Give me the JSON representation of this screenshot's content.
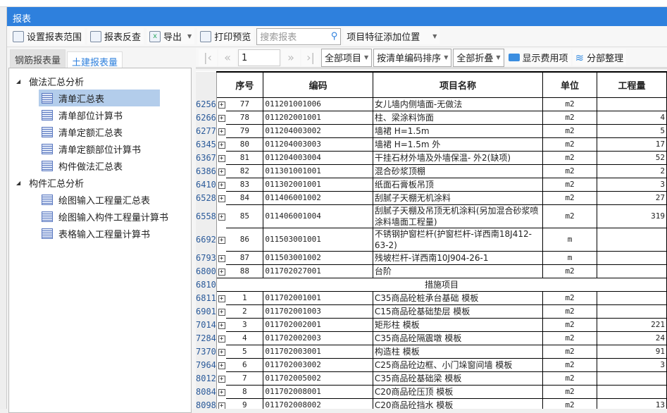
{
  "window": {
    "title": "报表"
  },
  "toolbar": {
    "set_range": "设置报表范围",
    "reverse_check": "报表反查",
    "export": "导出",
    "print_preview": "打印预览",
    "search_placeholder": "搜索报表",
    "feature_position": "项目特征添加位置"
  },
  "left": {
    "tabs": [
      {
        "label": "钢筋报表量",
        "active": false
      },
      {
        "label": "土建报表量",
        "active": true
      }
    ],
    "groups": [
      {
        "label": "做法汇总分析",
        "items": [
          "清单汇总表",
          "清单部位计算书",
          "清单定额汇总表",
          "清单定额部位计算书",
          "构件做法汇总表"
        ]
      },
      {
        "label": "构件汇总分析",
        "items": [
          "绘图输入工程量汇总表",
          "绘图输入构件工程量计算书",
          "表格输入工程量计算书"
        ]
      }
    ],
    "selected": "清单汇总表"
  },
  "pager": {
    "page": "1",
    "filter": "全部项目",
    "sort": "按清单编码排序",
    "fold": "全部折叠",
    "show_fee": "显示费用项",
    "section_arrange": "分部整理"
  },
  "table": {
    "headers": [
      "序号",
      "编码",
      "项目名称",
      "单位",
      "工程量"
    ],
    "rows": [
      {
        "line": "6256",
        "no": "77",
        "code": "011201001006",
        "name": "女儿墙内侧墙面-无做法",
        "unit": "m2",
        "qty": ""
      },
      {
        "line": "6266",
        "no": "78",
        "code": "011202001001",
        "name": "柱、梁涂料饰面",
        "unit": "m2",
        "qty": "4"
      },
      {
        "line": "6277",
        "no": "79",
        "code": "011204003002",
        "name": "墙裙 H=1.5m",
        "unit": "m2",
        "qty": "5"
      },
      {
        "line": "6345",
        "no": "80",
        "code": "011204003003",
        "name": "墙裙 H=1.5m 外",
        "unit": "m2",
        "qty": "17"
      },
      {
        "line": "6367",
        "no": "81",
        "code": "011204003004",
        "name": "干挂石材外墙及外墙保温- 外2(缺项)",
        "unit": "m2",
        "qty": "52"
      },
      {
        "line": "6386",
        "no": "82",
        "code": "011301001001",
        "name": "混合砂浆顶棚",
        "unit": "m2",
        "qty": "2"
      },
      {
        "line": "6410",
        "no": "83",
        "code": "011302001001",
        "name": "纸面石膏板吊顶",
        "unit": "m2",
        "qty": "3"
      },
      {
        "line": "6528",
        "no": "84",
        "code": "011406001002",
        "name": "刮腻子天棚无机涂料",
        "unit": "m2",
        "qty": "27"
      },
      {
        "line": "6558",
        "no": "85",
        "code": "011406001004",
        "name": "刮腻子天棚及吊顶无机涂料(另加混合砂浆喷涂料墙面工程量)",
        "unit": "m2",
        "qty": "319"
      },
      {
        "line": "6692",
        "no": "86",
        "code": "011503001001",
        "name": "不锈钢护窗栏杆(护窗栏杆-详西南18J412-63-2)",
        "unit": "m",
        "qty": ""
      },
      {
        "line": "6793",
        "no": "87",
        "code": "011503001002",
        "name": "残坡栏杆-详西南10J904-26-1",
        "unit": "m",
        "qty": ""
      },
      {
        "line": "6800",
        "no": "88",
        "code": "011702027001",
        "name": "台阶",
        "unit": "m2",
        "qty": ""
      },
      {
        "line": "6810",
        "section": "措施项目"
      },
      {
        "line": "6811",
        "no": "1",
        "code": "011702001001",
        "name": "C35商品砼桩承台基础 模板",
        "unit": "m2",
        "qty": ""
      },
      {
        "line": "6901",
        "no": "2",
        "code": "011702001003",
        "name": "C15商品砼基础垫层 模板",
        "unit": "m2",
        "qty": ""
      },
      {
        "line": "7014",
        "no": "3",
        "code": "011702002001",
        "name": "矩形柱 模板",
        "unit": "m2",
        "qty": "221"
      },
      {
        "line": "7284",
        "no": "4",
        "code": "011702002003",
        "name": "C35商品砼隔震墩 模板",
        "unit": "m2",
        "qty": "24"
      },
      {
        "line": "7370",
        "no": "5",
        "code": "011702003001",
        "name": "构造柱 模板",
        "unit": "m2",
        "qty": "91"
      },
      {
        "line": "7964",
        "no": "6",
        "code": "011702003002",
        "name": "C25商品砼边框、小门垛窗间墙 模板",
        "unit": "m2",
        "qty": "3"
      },
      {
        "line": "8012",
        "no": "7",
        "code": "011702005002",
        "name": "C35商品砼基础梁 模板",
        "unit": "m2",
        "qty": ""
      },
      {
        "line": "8084",
        "no": "8",
        "code": "011702008001",
        "name": "C20商品砼压顶 模板",
        "unit": "m2",
        "qty": ""
      },
      {
        "line": "8098",
        "no": "9",
        "code": "011702008002",
        "name": "C20商品砼挡水 模板",
        "unit": "m2",
        "qty": "13"
      }
    ]
  }
}
